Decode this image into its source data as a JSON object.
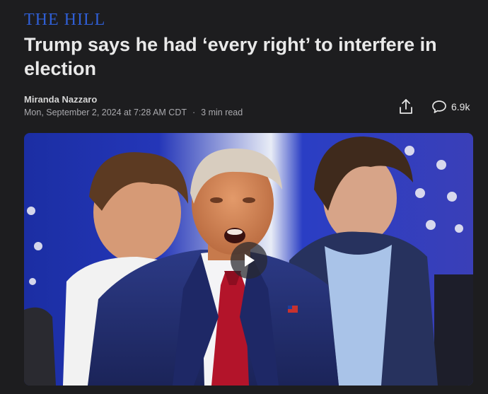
{
  "publisher": {
    "logo_text": "THE HILL"
  },
  "article": {
    "title": "Trump says he had ‘every right’ to interfere in election",
    "author": "Miranda Nazzaro",
    "published": "Mon, September 2, 2024 at 7:28 AM CDT",
    "separator": "·",
    "read_time": "3 min read"
  },
  "actions": {
    "comment_count": "6.9k",
    "share_icon": "share-upload-icon",
    "comment_icon": "speech-bubble-icon"
  },
  "media": {
    "type": "video",
    "play_icon": "play-icon"
  },
  "colors": {
    "background": "#1d1d1f",
    "logo_blue": "#2f5fd6",
    "suit_navy": "#24306e",
    "tie_red": "#b3142a"
  }
}
